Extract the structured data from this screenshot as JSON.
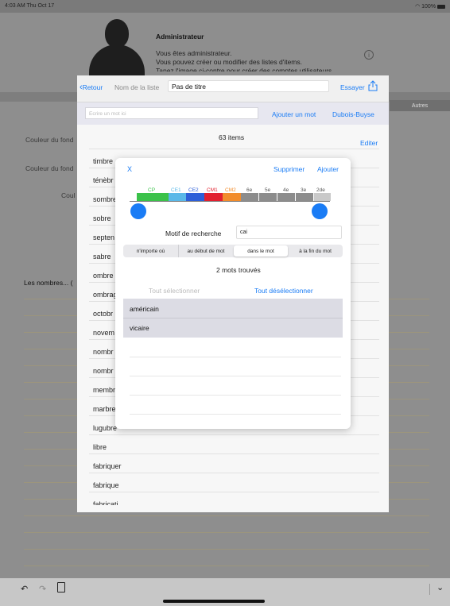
{
  "status": {
    "time": "4:03 AM  Thu Oct 17",
    "battery": "100%"
  },
  "admin": {
    "title": "Administrateur",
    "line1": "Vous êtes administrateur.",
    "line2": "Vous pouvez créer ou modifier des listes d'items.",
    "line3": "Tapez l'image ci-contre pour créer des comptes utilisateurs"
  },
  "background": {
    "autres": "Autres",
    "couleur_fond_1": "Couleur du fond",
    "couleur_fond_2": "Couleur du fond",
    "couleur_3": "Coul",
    "les_nombres": "Les nombres... ("
  },
  "list_editor": {
    "back_label": "Retour",
    "name_label": "Nom de la liste",
    "name_value": "Pas de titre",
    "try_label": "Essayer",
    "word_placeholder": "Ecrire un mot ici",
    "add_word": "Ajouter un mot",
    "dubois_buyse": "Dubois-Buyse",
    "item_count": "63 items",
    "edit_label": "Editer",
    "words": [
      "timbre",
      "ténèbr",
      "sombre",
      "sobre",
      "septen",
      "sabre",
      "ombre",
      "ombrage",
      "octobr",
      "novem",
      "nombr",
      "nombr",
      "membr",
      "marbre",
      "lugubre",
      "libre",
      "fabriquer",
      "fabrique",
      "fabricati"
    ]
  },
  "modal": {
    "close": "X",
    "delete": "Supprimer",
    "add": "Ajouter",
    "levels": [
      {
        "label": "CP",
        "color": "#3bc24a"
      },
      {
        "label": "CE1",
        "color": "#59b8e8"
      },
      {
        "label": "CE2",
        "color": "#2d5fd8"
      },
      {
        "label": "CM1",
        "color": "#e2202f"
      },
      {
        "label": "CM2",
        "color": "#f28c2b"
      },
      {
        "label": "6e",
        "color": "#8c8c8c"
      },
      {
        "label": "5e",
        "color": "#8c8c8c"
      },
      {
        "label": "4e",
        "color": "#8c8c8c"
      },
      {
        "label": "3e",
        "color": "#8c8c8c"
      },
      {
        "label": "2de",
        "color": "#8c8c8c"
      }
    ],
    "pattern_label": "Motif de recherche",
    "pattern_value": "cai",
    "segments": [
      "n'importe où",
      "au début de mot",
      "dans le mot",
      "à la fin du mot"
    ],
    "selected_segment": "dans le mot",
    "found": "2 mots trouvés",
    "select_all": "Tout sélectionner",
    "deselect_all": "Tout désélectionner",
    "results": [
      "américain",
      "vicaire"
    ]
  }
}
